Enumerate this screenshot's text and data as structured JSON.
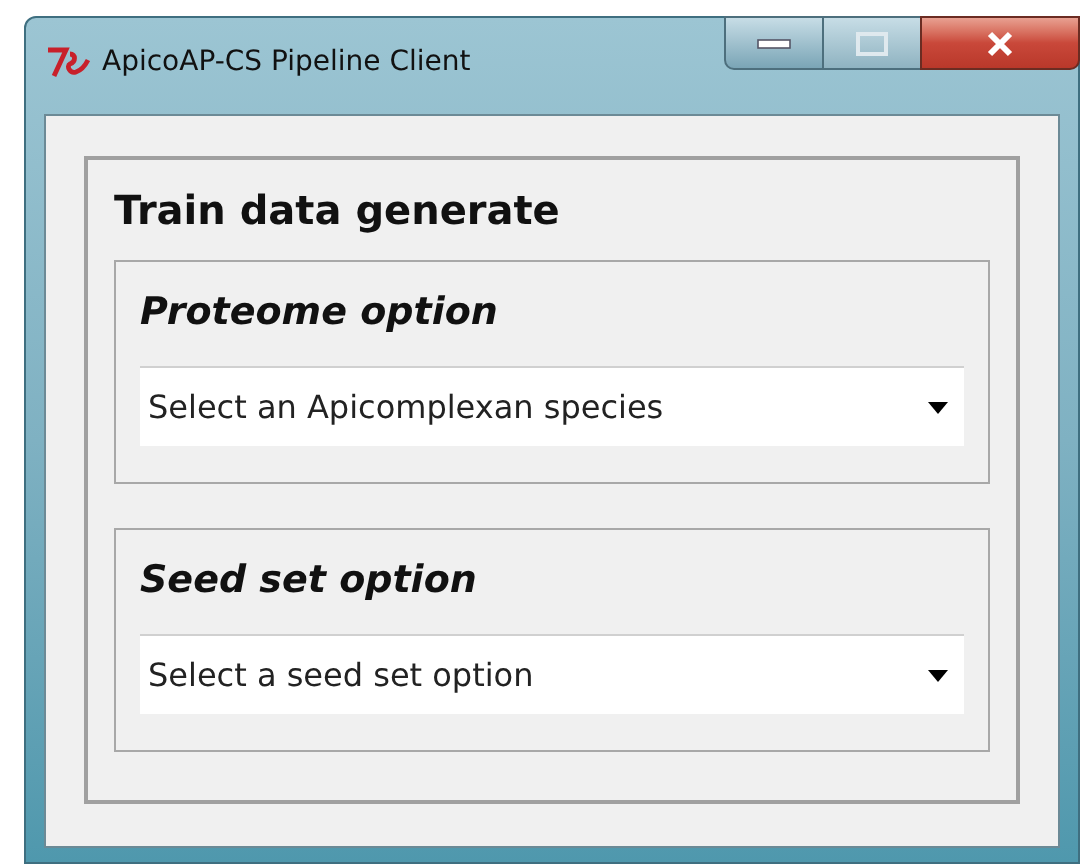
{
  "window": {
    "title": "ApicoAP-CS Pipeline Client"
  },
  "panel": {
    "title": "Train data generate"
  },
  "groups": [
    {
      "title": "Proteome option",
      "combobox": {
        "value": "Select an Apicomplexan species"
      }
    },
    {
      "title": "Seed set option",
      "combobox": {
        "value": "Select a seed set option"
      }
    }
  ]
}
